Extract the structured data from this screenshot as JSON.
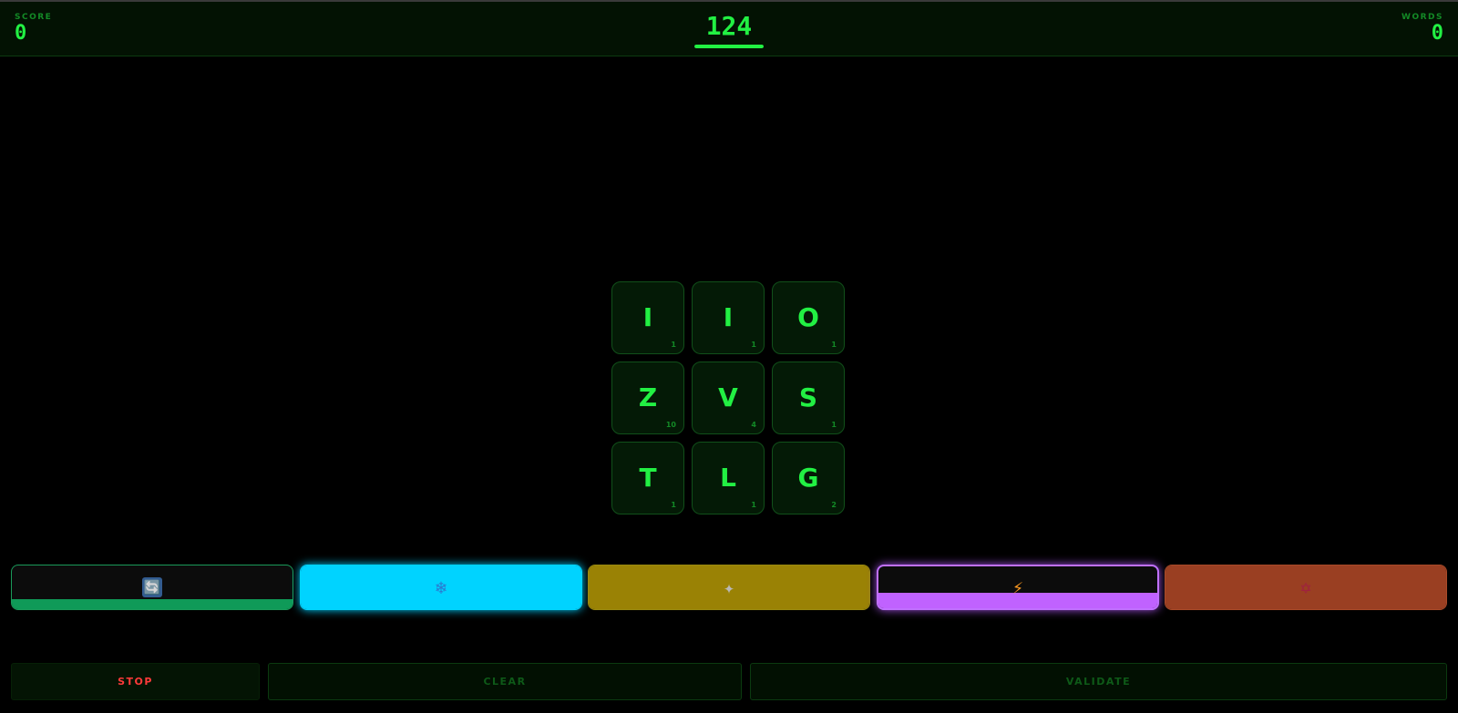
{
  "header": {
    "score_label": "SCORE",
    "score_value": "0",
    "timer_value": "124",
    "timer_progress": 1.0,
    "words_label": "WORDS",
    "words_value": "0"
  },
  "tiles": [
    {
      "letter": "I",
      "points": "1"
    },
    {
      "letter": "I",
      "points": "1"
    },
    {
      "letter": "O",
      "points": "1"
    },
    {
      "letter": "Z",
      "points": "10"
    },
    {
      "letter": "V",
      "points": "4"
    },
    {
      "letter": "S",
      "points": "1"
    },
    {
      "letter": "T",
      "points": "1"
    },
    {
      "letter": "L",
      "points": "1"
    },
    {
      "letter": "G",
      "points": "2"
    }
  ],
  "powerups": [
    {
      "icon": "shuffle-icon",
      "glyph": "🔄",
      "color": "#0f9a58",
      "charge": 0.22
    },
    {
      "icon": "freeze-icon",
      "glyph": "❄",
      "color": "#00d3ff",
      "charge": 1.0
    },
    {
      "icon": "sparkle-icon",
      "glyph": "✦",
      "color": "#9a8205",
      "charge": 1.0
    },
    {
      "icon": "lightning-icon",
      "glyph": "⚡",
      "color": "#c062ff",
      "charge": 0.38
    },
    {
      "icon": "star-burst-icon",
      "glyph": "✡",
      "color": "#9a3f22",
      "charge": 1.0
    }
  ],
  "actions": {
    "stop_label": "STOP",
    "clear_label": "CLEAR",
    "validate_label": "VALIDATE"
  },
  "colors": {
    "accent": "#22f043",
    "stop": "#ff3a3a",
    "background": "#000000"
  }
}
